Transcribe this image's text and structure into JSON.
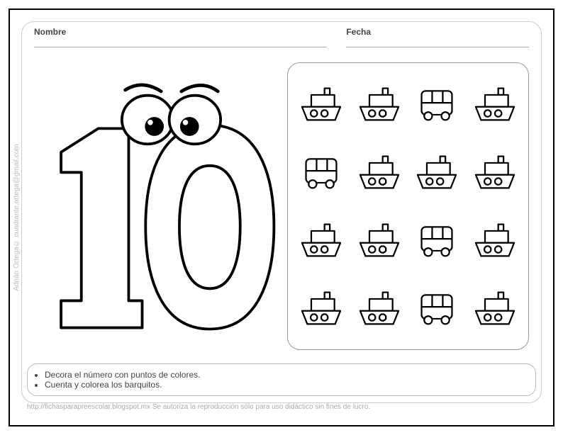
{
  "header": {
    "name_label": "Nombre",
    "date_label": "Fecha"
  },
  "number_display": "10",
  "objects": {
    "grid": [
      [
        "boat",
        "boat",
        "bus",
        "boat"
      ],
      [
        "bus",
        "boat",
        "boat",
        "boat"
      ],
      [
        "boat",
        "boat",
        "bus",
        "boat"
      ],
      [
        "boat",
        "boat",
        "bus",
        "boat"
      ]
    ]
  },
  "instructions": {
    "line1": "Decora el número con puntos de colores.",
    "line2": "Cuenta y colorea los barquitos."
  },
  "footer": "http://fichasparapreescolar.blogspot.mx   Se autoriza la reproducción sólo para uso didáctico sin fines de lucro.",
  "side_credit": "Adrián Ortega©  cuadrante.ortega@gmail.com"
}
